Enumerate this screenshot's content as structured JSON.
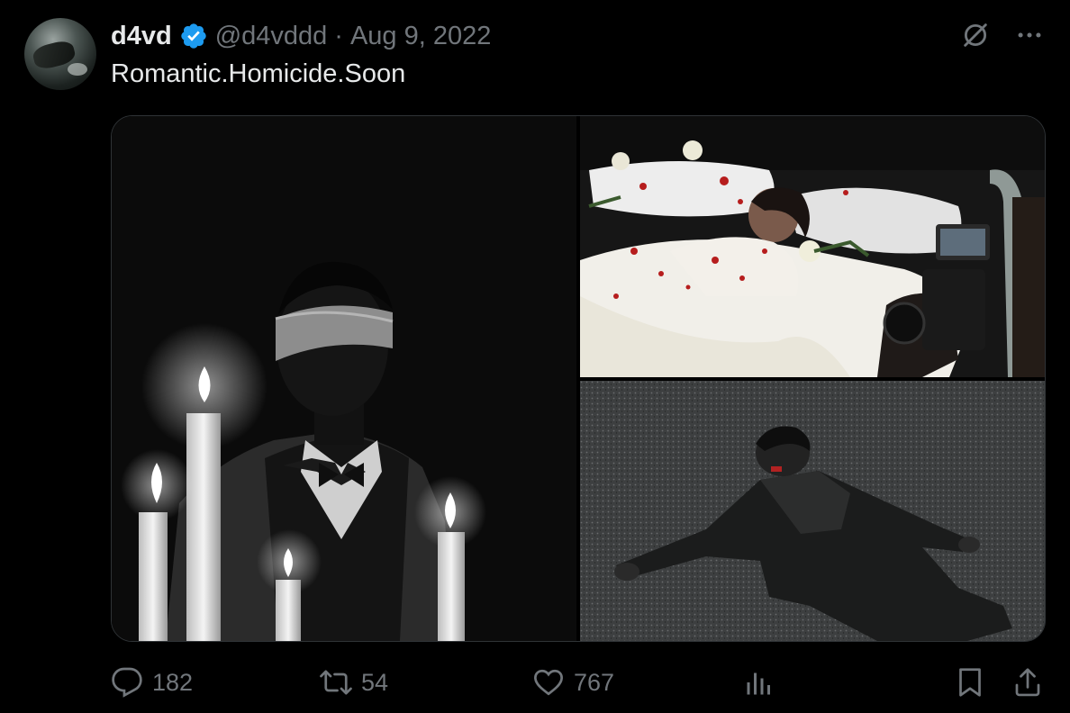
{
  "tweet": {
    "author": {
      "display_name": "d4vd",
      "verified": true,
      "handle": "@d4vddd",
      "avatar_icon": "profile-avatar"
    },
    "separator": "·",
    "date": "Aug 9, 2022",
    "text": "Romantic.Homicide.Soon",
    "media_count": 3,
    "stats": {
      "replies": "182",
      "reposts": "54",
      "likes": "767"
    }
  },
  "icons": {
    "verified": "verified-badge-icon",
    "grok": "grok-icon",
    "more": "more-icon",
    "reply": "reply-icon",
    "repost": "repost-icon",
    "like": "heart-icon",
    "views": "analytics-icon",
    "bookmark": "bookmark-icon",
    "share": "share-icon"
  },
  "colors": {
    "background": "#000000",
    "text_primary": "#e7e9ea",
    "text_secondary": "#71767b",
    "verified_blue": "#1d9bf0"
  }
}
